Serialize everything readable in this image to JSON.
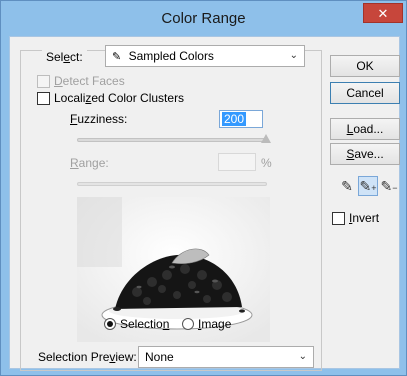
{
  "window": {
    "title": "Color Range",
    "close_glyph": "✕"
  },
  "select": {
    "label": "Select:",
    "value": "Sampled Colors",
    "icon": "eyedropper-icon"
  },
  "checkboxes": {
    "detect_faces": {
      "label": "Detect Faces",
      "checked": false,
      "enabled": false
    },
    "localized": {
      "label": "Localized Color Clusters",
      "checked": false,
      "enabled": true
    }
  },
  "fuzziness": {
    "label": "Fuzziness:",
    "value": "200",
    "slider_level": 1.0
  },
  "range": {
    "label": "Range:",
    "unit": "%",
    "value": ""
  },
  "view_mode": {
    "selection_label": "Selection",
    "image_label": "Image",
    "selected": "selection"
  },
  "selection_preview": {
    "label": "Selection Preview:",
    "value": "None"
  },
  "buttons": {
    "ok": "OK",
    "cancel": "Cancel",
    "load": "Load...",
    "save": "Save..."
  },
  "eyedroppers": [
    "eyedropper-icon",
    "eyedropper-plus-icon",
    "eyedropper-minus-icon"
  ],
  "invert": {
    "label": "Invert",
    "checked": false
  }
}
